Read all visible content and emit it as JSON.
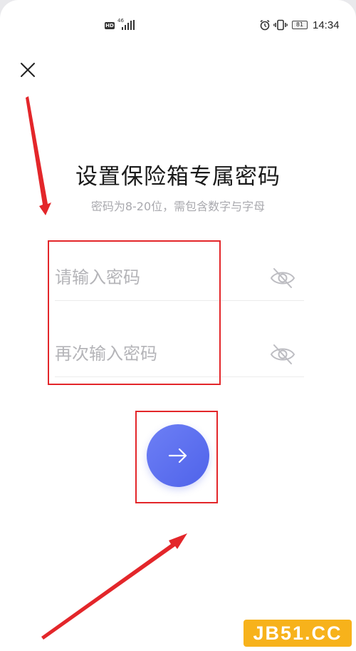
{
  "status_bar": {
    "hd_label": "HD",
    "network_label": "46",
    "battery_level": "81",
    "time": "14:34",
    "icons": [
      "signal-icon",
      "alarm-icon",
      "vibrate-icon",
      "battery-icon"
    ]
  },
  "header": {
    "close_icon": "close-icon"
  },
  "title": "设置保险箱专属密码",
  "subtitle": "密码为8-20位，需包含数字与字母",
  "fields": [
    {
      "placeholder": "请输入密码",
      "value": "",
      "toggle_icon": "eye-hidden-icon"
    },
    {
      "placeholder": "再次输入密码",
      "value": "",
      "toggle_icon": "eye-hidden-icon"
    }
  ],
  "next_button": {
    "icon": "arrow-right-icon"
  },
  "annotations": {
    "color": "#e3262a"
  },
  "watermark": "JB51.CC",
  "colors": {
    "accent": "#5a6ff0",
    "annotation": "#e3262a",
    "watermark_bg": "#f7b21b"
  }
}
